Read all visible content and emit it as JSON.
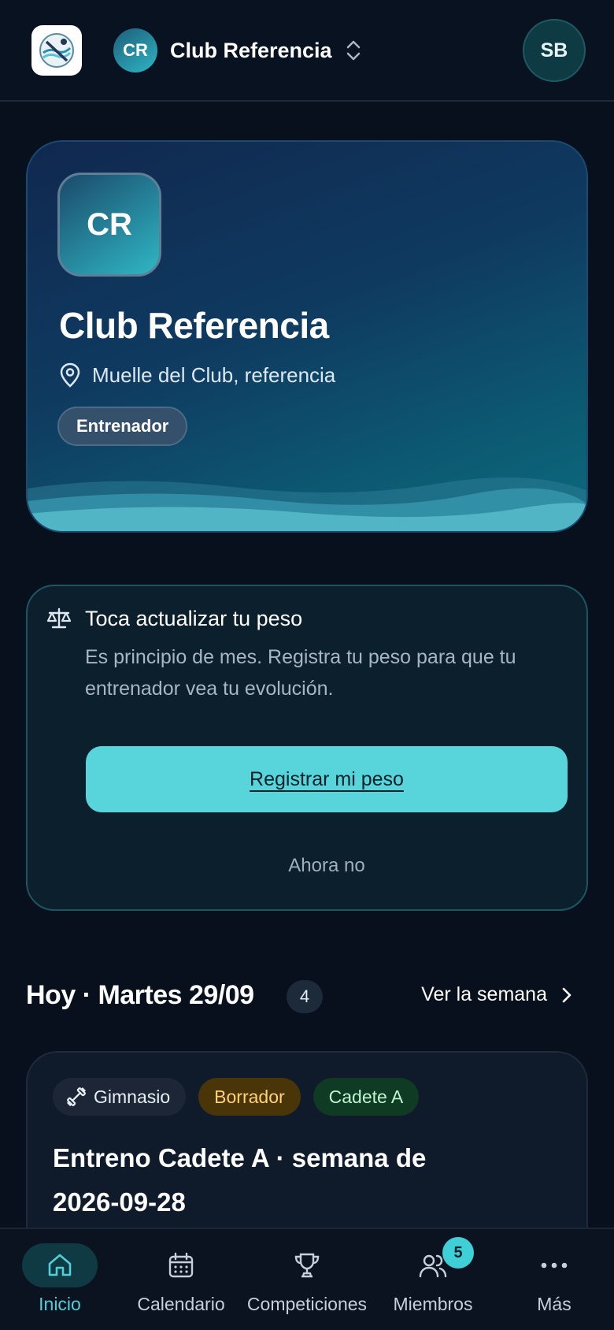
{
  "header": {
    "app_logo": "swimmer-logo-icon",
    "club_initials": "CR",
    "club_name": "Club Referencia",
    "user_initials": "SB"
  },
  "hero": {
    "initials": "CR",
    "title": "Club Referencia",
    "location": "Muelle del Club, referencia",
    "role": "Entrenador"
  },
  "weight_prompt": {
    "title": "Toca actualizar tu peso",
    "text": "Es principio de mes. Registra tu peso para que tu entrenador vea tu evolución.",
    "primary_label": "Registrar mi peso",
    "dismiss_label": "Ahora no"
  },
  "today": {
    "title": "Hoy · Martes 29/09",
    "count": "4",
    "see_week_label": "Ver la semana"
  },
  "session": {
    "tags": {
      "location": "Gimnasio",
      "status": "Borrador",
      "group": "Cadete A"
    },
    "title": "Entreno Cadete A · semana de 2026-09-28"
  },
  "nav": {
    "home": "Inicio",
    "calendar": "Calendario",
    "competitions": "Competiciones",
    "members": "Miembros",
    "members_badge": "5",
    "more": "Más"
  },
  "colors": {
    "background": "#07101c",
    "accent": "#58d4db",
    "nav_active": "#4fd0d8",
    "draft": "#ffd27a",
    "group": "#bff3d0"
  }
}
